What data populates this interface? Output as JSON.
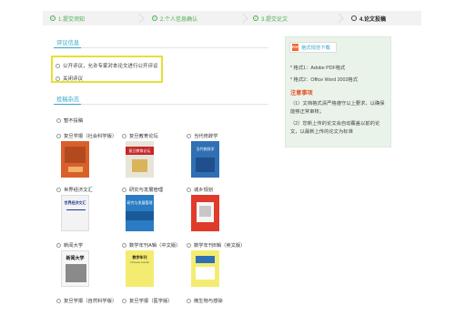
{
  "steps": [
    {
      "label": "1.提交须知",
      "state": "done"
    },
    {
      "label": "2.个人信息确认",
      "state": "done"
    },
    {
      "label": "3.提交论文",
      "state": "done"
    },
    {
      "label": "4.论文投稿",
      "state": "current"
    }
  ],
  "review": {
    "title": "评议信息",
    "options": [
      "公开评议，允许专家对本论文进行公开评议",
      "关闭评议"
    ]
  },
  "journals": {
    "title": "投稿杂志",
    "none_label": "暂不投稿",
    "items": [
      {
        "name": "复旦学报（社会科学版）",
        "cover_color": "#d8602b"
      },
      {
        "name": "复旦教育论坛",
        "cover_color": "#e8e4d8"
      },
      {
        "name": "当代修辞学",
        "cover_color": "#2f6fb4"
      },
      {
        "name": "世界经济文汇",
        "cover_color": "#f3f3f6"
      },
      {
        "name": "研究与发展管理",
        "cover_color": "#2a7cc4"
      },
      {
        "name": "城乡规划",
        "cover_color": "#e03a2b"
      },
      {
        "name": "新闻大学",
        "cover_color": "#f6f6f6"
      },
      {
        "name": "数学年刊A辑（中文版）",
        "cover_color": "#f4ec70"
      },
      {
        "name": "数学年刊B辑（英文版）",
        "cover_color": "#f4ec70"
      },
      {
        "name": "复旦学报（自然科学版）"
      },
      {
        "name": "复旦学报（医学版）"
      },
      {
        "name": "微生物与感染"
      }
    ],
    "cover_texts": {
      "c2": "复旦教育论坛",
      "c3": "当代修辞学",
      "c4": "世界经济文汇",
      "c5": "研究与发展管理",
      "c7": "新闻大学",
      "c8": "数学年刊",
      "c8sub": "Chinese Annals"
    }
  },
  "panel": {
    "download_label": "格式规范下载",
    "format1": "* 格式1：Adobe PDF格式",
    "format2": "* 格式2：Office Word 2003格式",
    "notes_title": "注意事项",
    "note1a": "（1）文档格式清严格遵守以上要求，以确保",
    "note1b": "能够正常审核；",
    "note2a": "（2）您新上传的论文会自动覆盖以前的论",
    "note2b": "文，以最新上传的论文为标准"
  },
  "colors": {
    "accent": "#3aa6c8",
    "success": "#4caf50",
    "warning": "#e0592b",
    "highlight": "#e8df34"
  }
}
